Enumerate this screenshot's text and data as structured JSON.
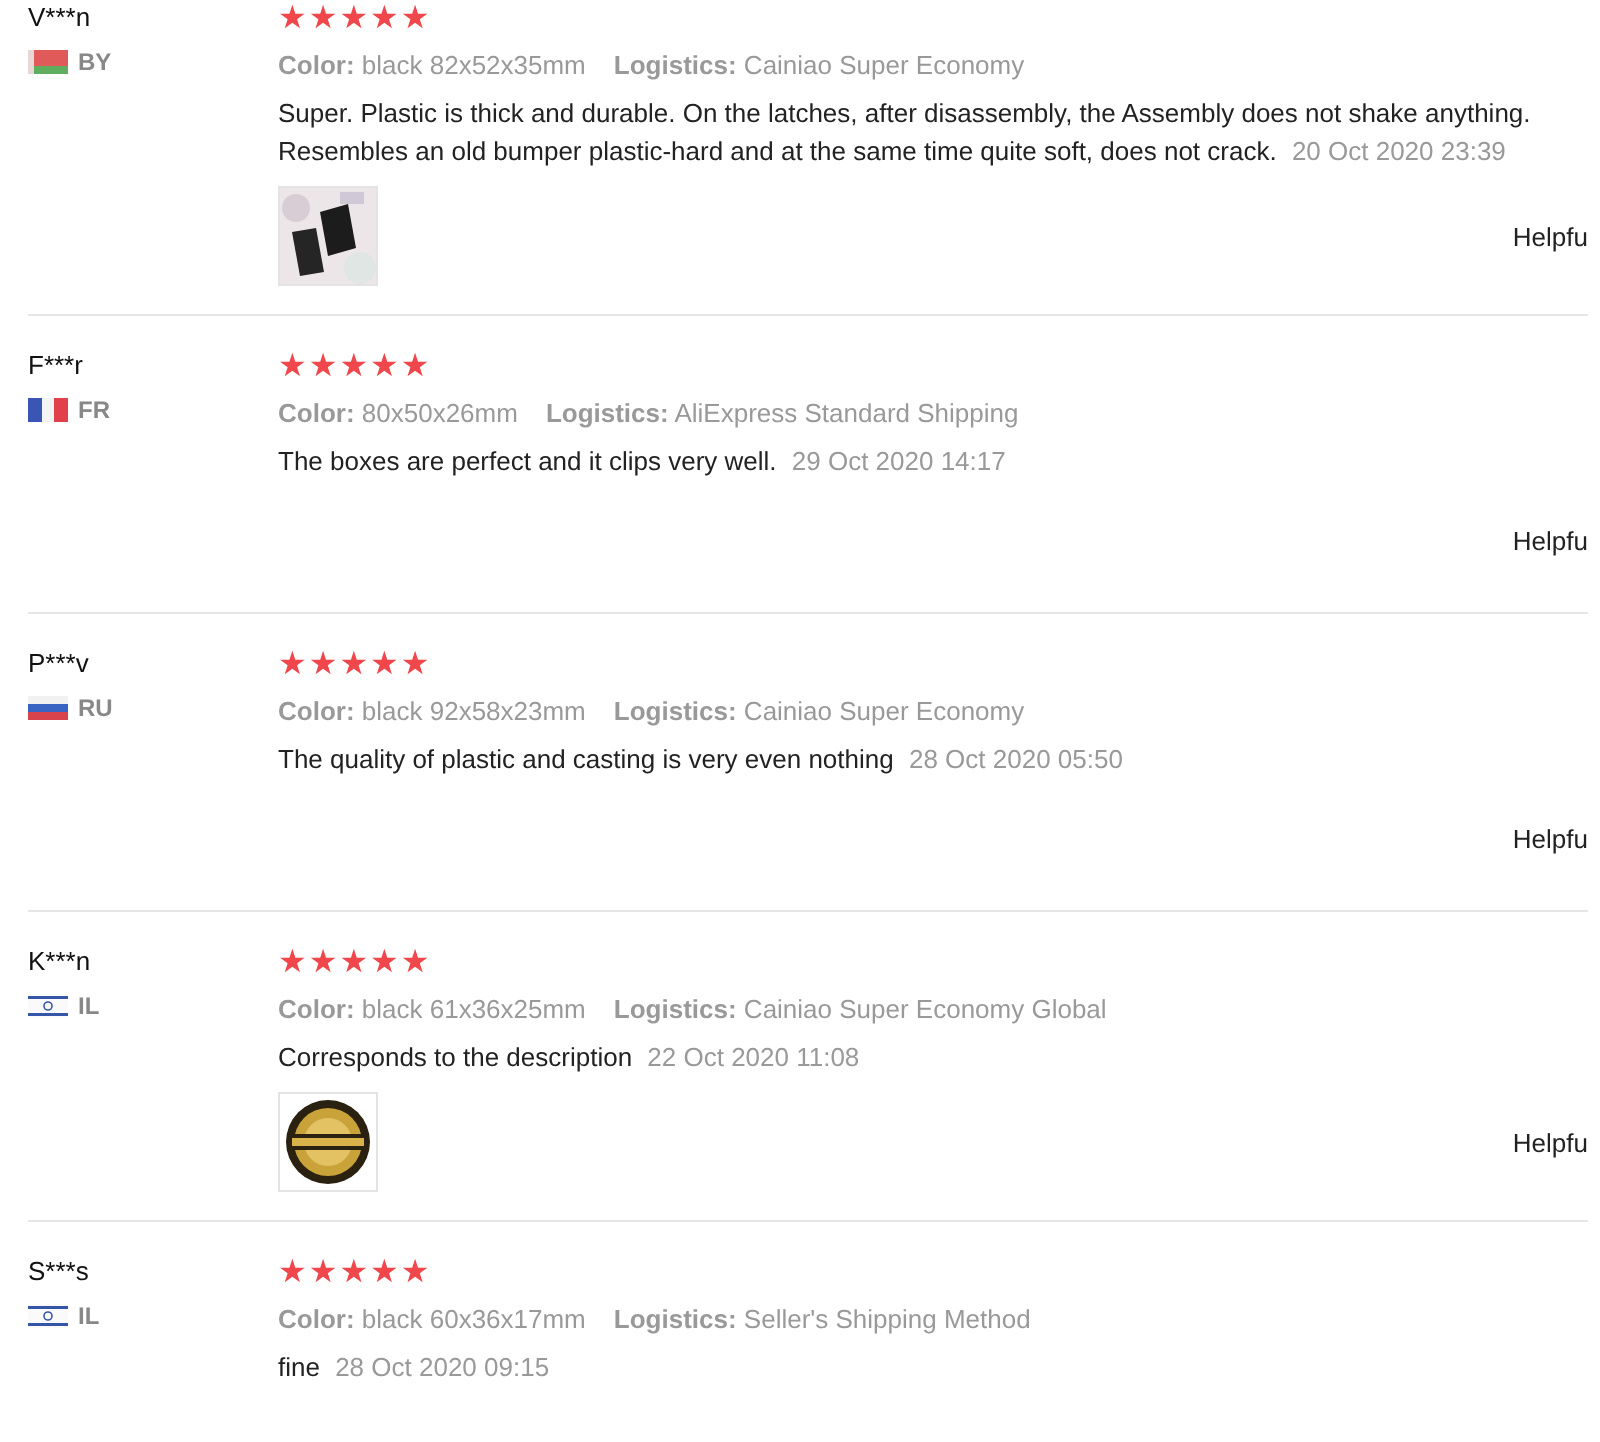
{
  "reviews": [
    {
      "name": "V***n",
      "country": {
        "code": "BY",
        "kind": "belarus"
      },
      "stars": 5,
      "color_label": "Color:",
      "color_value": "black 82x52x35mm",
      "logistics_label": "Logistics:",
      "logistics_value": "Cainiao Super Economy",
      "text": "Super. Plastic is thick and durable. On the latches, after disassembly, the Assembly does not shake anything. Resembles an old bumper plastic-hard and at the same time quite soft, does not crack.",
      "date": "20 Oct 2020 23:39",
      "photos": [
        {
          "kind": "picture"
        }
      ],
      "helpful": "Helpfu"
    },
    {
      "name": "F***r",
      "country": {
        "code": "FR",
        "kind": "france"
      },
      "stars": 5,
      "color_label": "Color:",
      "color_value": "80x50x26mm",
      "logistics_label": "Logistics:",
      "logistics_value": "AliExpress Standard Shipping",
      "text": "The boxes are perfect and it clips very well.",
      "date": "29 Oct 2020 14:17",
      "helpful": "Helpfu"
    },
    {
      "name": "P***v",
      "country": {
        "code": "RU",
        "kind": "russia"
      },
      "stars": 5,
      "color_label": "Color:",
      "color_value": "black 92x58x23mm",
      "logistics_label": "Logistics:",
      "logistics_value": "Cainiao Super Economy",
      "text": "The quality of plastic and casting is very even nothing",
      "date": "28 Oct 2020 05:50",
      "helpful": "Helpfu"
    },
    {
      "name": "K***n",
      "country": {
        "code": "IL",
        "kind": "israel"
      },
      "stars": 5,
      "color_label": "Color:",
      "color_value": "black 61x36x25mm",
      "logistics_label": "Logistics:",
      "logistics_value": "Cainiao Super Economy Global",
      "text": "Corresponds to the description",
      "date": "22 Oct 2020 11:08",
      "photos": [
        {
          "kind": "picture"
        }
      ],
      "helpful": "Helpfu"
    },
    {
      "name": "S***s",
      "country": {
        "code": "IL",
        "kind": "israel"
      },
      "stars": 5,
      "color_label": "Color:",
      "color_value": "black 60x36x17mm",
      "logistics_label": "Logistics:",
      "logistics_value": "Seller's Shipping Method",
      "text": "fine",
      "date": "28 Oct 2020 09:15"
    }
  ]
}
